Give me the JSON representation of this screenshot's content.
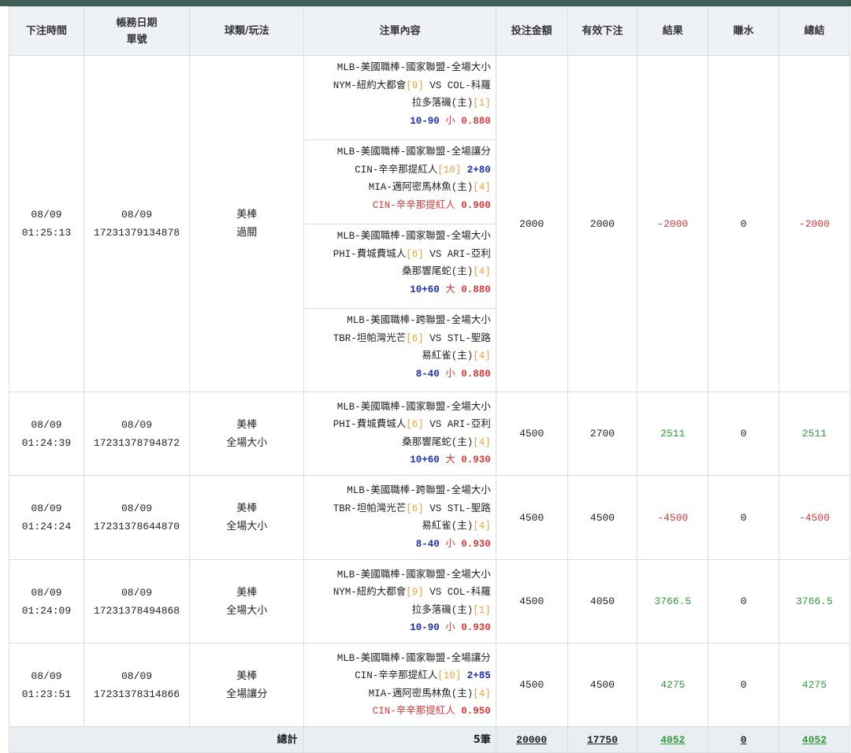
{
  "headers": {
    "time": "下注時間",
    "date_line1": "帳務日期",
    "date_line2": "單號",
    "sport": "球類/玩法",
    "content": "注單內容",
    "stake": "投注金額",
    "valid": "有效下注",
    "result": "結果",
    "rebate": "賺水",
    "total": "總結"
  },
  "rows": [
    {
      "time_date": "08/09",
      "time_clock": "01:25:13",
      "acct_date": "08/09",
      "order_no": "17231379134878",
      "sport": "美棒",
      "play": "過關",
      "picks": [
        {
          "league": "MLB-美國職棒-國家聯盟-全場大小",
          "home_pre": "NYM-紐約大都會",
          "home_rank": "[9]",
          "vs": " VS ",
          "away_pre": "COL-科羅",
          "away_tail": "拉多落磯(主)",
          "away_rank": "[1]",
          "line": "10-90",
          "side": " 小 ",
          "odds": "0.880"
        },
        {
          "league": "MLB-美國職棒-國家聯盟-全場讓分",
          "home_pre": "CIN-辛辛那提紅人",
          "home_rank": "[10]",
          "handicap": " 2+80",
          "away_tail": "MIA-邁阿密馬林魚(主)",
          "away_rank": "[4]",
          "pick_team": "CIN-辛辛那提紅人",
          "odds": " 0.900"
        },
        {
          "league": "MLB-美國職棒-國家聯盟-全場大小",
          "home_pre": "PHI-費城費城人",
          "home_rank": "[6]",
          "vs": " VS ",
          "away_pre": "ARI-亞利",
          "away_tail": "桑那響尾蛇(主)",
          "away_rank": "[4]",
          "line": "10+60",
          "side": " 大 ",
          "odds": "0.880"
        },
        {
          "league": "MLB-美國職棒-跨聯盟-全場大小",
          "home_pre": "TBR-坦帕灣光芒",
          "home_rank": "[6]",
          "vs": " VS ",
          "away_pre": "STL-聖路",
          "away_tail": "易紅雀(主)",
          "away_rank": "[4]",
          "line": "8-40",
          "side": " 小 ",
          "odds": "0.880"
        }
      ],
      "stake": "2000",
      "valid": "2000",
      "result": "-2000",
      "rebate": "0",
      "total": "-2000",
      "tone": "neg"
    },
    {
      "time_date": "08/09",
      "time_clock": "01:24:39",
      "acct_date": "08/09",
      "order_no": "17231378794872",
      "sport": "美棒",
      "play": "全場大小",
      "picks": [
        {
          "league": "MLB-美國職棒-國家聯盟-全場大小",
          "home_pre": "PHI-費城費城人",
          "home_rank": "[6]",
          "vs": " VS ",
          "away_pre": "ARI-亞利",
          "away_tail": "桑那響尾蛇(主)",
          "away_rank": "[4]",
          "line": "10+60",
          "side": " 大 ",
          "odds": "0.930"
        }
      ],
      "stake": "4500",
      "valid": "2700",
      "result": "2511",
      "rebate": "0",
      "total": "2511",
      "tone": "pos"
    },
    {
      "time_date": "08/09",
      "time_clock": "01:24:24",
      "acct_date": "08/09",
      "order_no": "17231378644870",
      "sport": "美棒",
      "play": "全場大小",
      "picks": [
        {
          "league": "MLB-美國職棒-跨聯盟-全場大小",
          "home_pre": "TBR-坦帕灣光芒",
          "home_rank": "[6]",
          "vs": " VS ",
          "away_pre": "STL-聖路",
          "away_tail": "易紅雀(主)",
          "away_rank": "[4]",
          "line": "8-40",
          "side": " 小 ",
          "odds": "0.930"
        }
      ],
      "stake": "4500",
      "valid": "4500",
      "result": "-4500",
      "rebate": "0",
      "total": "-4500",
      "tone": "neg"
    },
    {
      "time_date": "08/09",
      "time_clock": "01:24:09",
      "acct_date": "08/09",
      "order_no": "17231378494868",
      "sport": "美棒",
      "play": "全場大小",
      "picks": [
        {
          "league": "MLB-美國職棒-國家聯盟-全場大小",
          "home_pre": "NYM-紐約大都會",
          "home_rank": "[9]",
          "vs": " VS ",
          "away_pre": "COL-科羅",
          "away_tail": "拉多落磯(主)",
          "away_rank": "[1]",
          "line": "10-90",
          "side": " 小 ",
          "odds": "0.930"
        }
      ],
      "stake": "4500",
      "valid": "4050",
      "result": "3766.5",
      "rebate": "0",
      "total": "3766.5",
      "tone": "pos"
    },
    {
      "time_date": "08/09",
      "time_clock": "01:23:51",
      "acct_date": "08/09",
      "order_no": "17231378314866",
      "sport": "美棒",
      "play": "全場讓分",
      "picks": [
        {
          "league": "MLB-美國職棒-國家聯盟-全場讓分",
          "home_pre": "CIN-辛辛那提紅人",
          "home_rank": "[10]",
          "handicap": " 2+85",
          "away_tail": "MIA-邁阿密馬林魚(主)",
          "away_rank": "[4]",
          "pick_team": "CIN-辛辛那提紅人",
          "odds": " 0.950"
        }
      ],
      "stake": "4500",
      "valid": "4500",
      "result": "4275",
      "rebate": "0",
      "total": "4275",
      "tone": "pos"
    }
  ],
  "footer": {
    "label": "總計",
    "count": "5筆",
    "stake": "20000",
    "valid": "17750",
    "result": "4052",
    "rebate": "0",
    "total": "4052"
  },
  "colors": {
    "header_bar": "#3f5e56",
    "negative": "#d23b3b",
    "positive": "#2f9a3a",
    "line_blue": "#1f2fa8",
    "rank_orange": "#e8a33a"
  }
}
